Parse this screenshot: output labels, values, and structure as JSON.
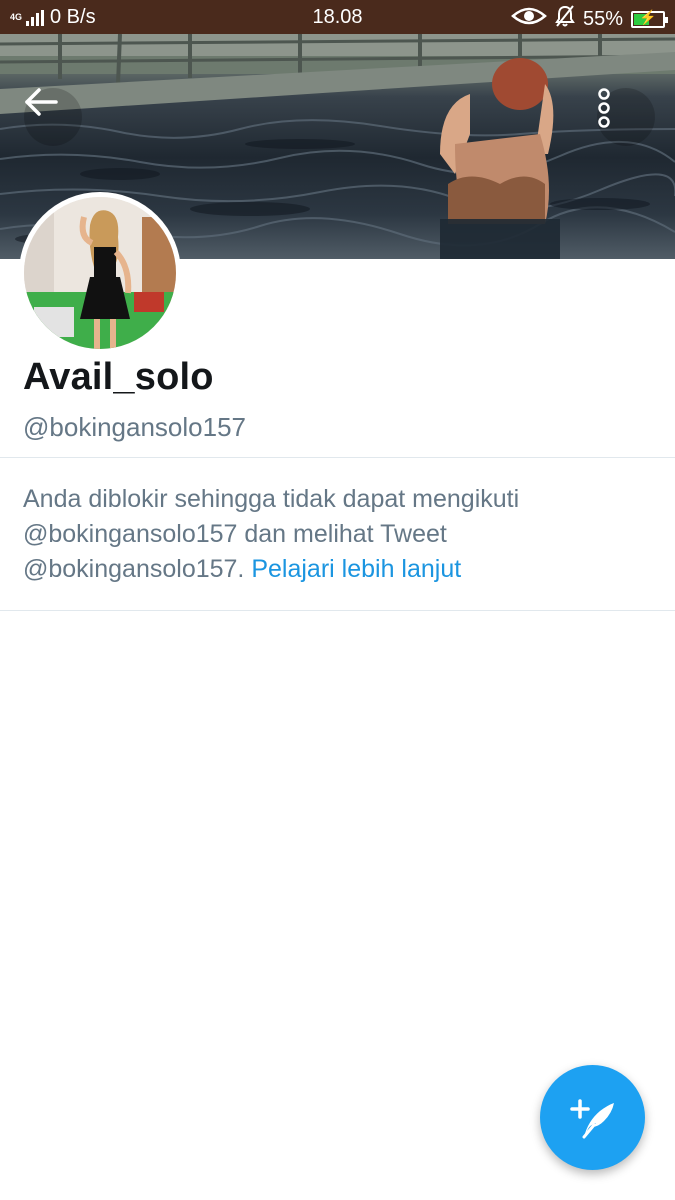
{
  "status_bar": {
    "network_type": "4G",
    "data_speed": "0 B/s",
    "time": "18.08",
    "battery_percent": "55%",
    "battery_level": 0.55,
    "icons": [
      "eye-icon",
      "bell-muted-icon",
      "battery-charging-icon"
    ]
  },
  "header": {
    "back_icon": "arrow-left-icon",
    "more_icon": "more-vertical-icon"
  },
  "profile": {
    "display_name": "Avail_solo",
    "handle": "@bokingansolo157"
  },
  "blocked_notice": {
    "message": "Anda diblokir sehingga tidak dapat mengikuti @bokingansolo157 dan melihat Tweet @bokingansolo157.",
    "learn_more": "Pelajari lebih lanjut"
  },
  "compose_button": {
    "icon": "compose-tweet-icon"
  },
  "colors": {
    "status_bar_bg": "#4a2a1c",
    "link": "#1b95e0",
    "fab": "#1da1f2",
    "secondary_text": "#657786",
    "primary_text": "#14171a"
  }
}
